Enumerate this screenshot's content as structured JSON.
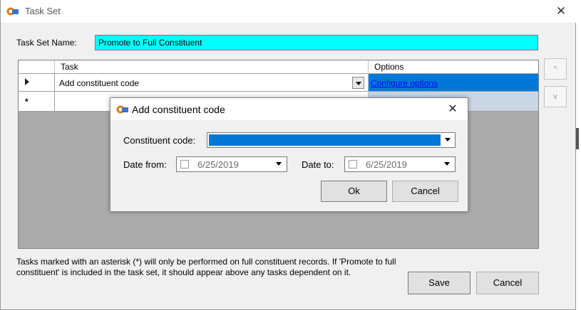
{
  "window": {
    "title": "Task Set",
    "close_glyph": "✕",
    "icon": "app-icon"
  },
  "form": {
    "name_label": "Task Set Name:",
    "name_value": "Promote to Full Constituent"
  },
  "grid": {
    "columns": [
      "Task",
      "Options"
    ],
    "rows": [
      {
        "indicator": "▶",
        "task": "Add constituent code",
        "options_link": "Configure options",
        "selected": true
      },
      {
        "indicator": "*",
        "task": "",
        "options_link": "",
        "selected": false
      }
    ]
  },
  "side_buttons": {
    "up": "^",
    "down": "v"
  },
  "note": "Tasks marked with an asterisk (*) will only be performed on full constituent records. If 'Promote to full constituent' is included in the task set, it should appear above any tasks dependent on it.",
  "buttons": {
    "save": "Save",
    "cancel": "Cancel"
  },
  "dialog": {
    "title": "Add constituent code",
    "close_glyph": "✕",
    "constituent_code_label": "Constituent code:",
    "constituent_code_value": "",
    "date_from_label": "Date from:",
    "date_from_value": "6/25/2019",
    "date_to_label": "Date to:",
    "date_to_value": "6/25/2019",
    "ok_label": "Ok",
    "cancel_label": "Cancel"
  },
  "colors": {
    "name_field_bg": "#00ffff",
    "selection": "#0078d7",
    "grid_bg": "#ababab",
    "link": "#0000ff"
  }
}
